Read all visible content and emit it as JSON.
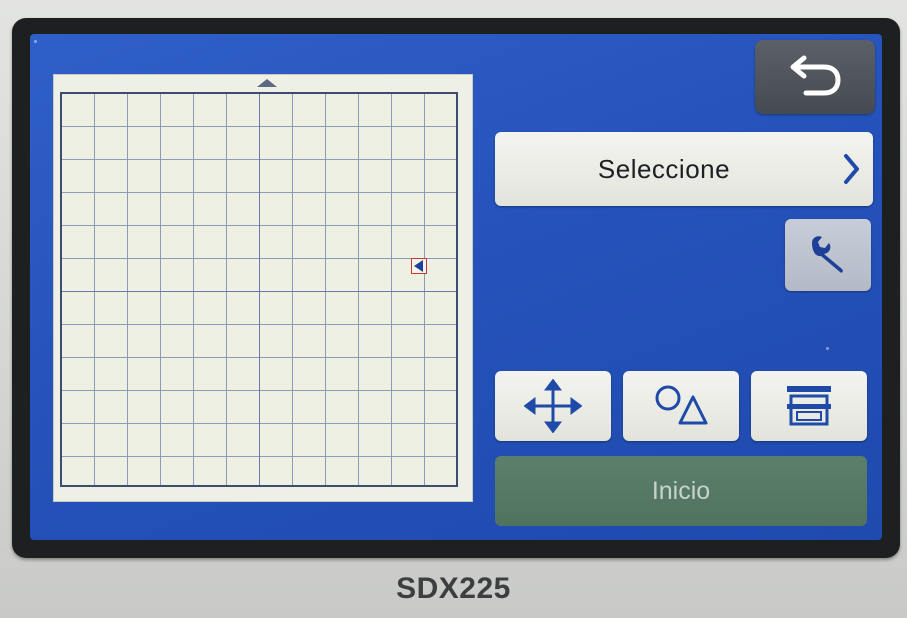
{
  "screen": {
    "select_button": {
      "label": "Seleccione",
      "icon": "chevron-right-icon"
    },
    "back_button": {
      "icon": "back-arrow-icon"
    },
    "settings_button": {
      "icon": "wrench-icon"
    },
    "tools": [
      {
        "icon": "move-arrows-icon"
      },
      {
        "icon": "shapes-circle-triangle-icon"
      },
      {
        "icon": "mat-tray-icon"
      }
    ],
    "start_button": {
      "label": "Inicio",
      "enabled": false
    }
  },
  "device": {
    "model": "SDX225"
  },
  "colors": {
    "screen_blue": "#2553bb",
    "button_light": "#e8eae2",
    "start_green": "#527662",
    "icon_blue": "#1f4aa8"
  }
}
